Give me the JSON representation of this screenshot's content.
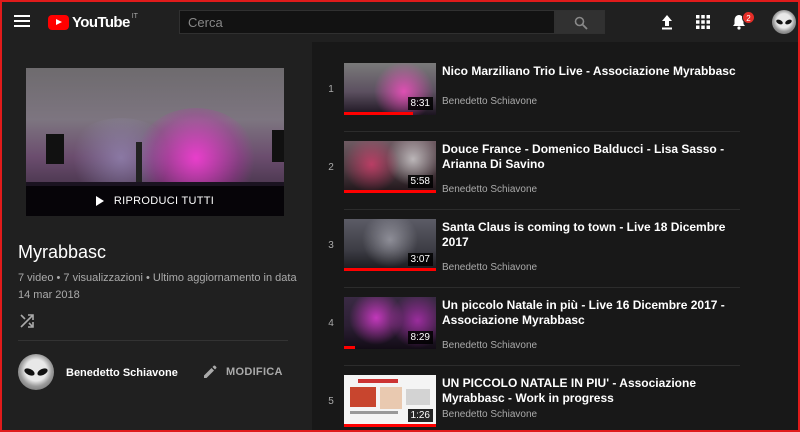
{
  "header": {
    "logo_text": "YouTube",
    "country_code": "IT",
    "search_placeholder": "Cerca",
    "notification_count": "2"
  },
  "playlist": {
    "play_all_label": "RIPRODUCI TUTTI",
    "title": "Myrabbasc",
    "meta": "7 video • 7 visualizzazioni • Ultimo aggiornamento in data 14 mar 2018",
    "owner": "Benedetto Schiavone",
    "edit_label": "MODIFICA"
  },
  "videos": [
    {
      "index": "1",
      "title": "Nico Marziliano Trio Live - Associazione Myrabbasc",
      "channel": "Benedetto Schiavone",
      "duration": "8:31",
      "progress": 0.75
    },
    {
      "index": "2",
      "title": "Douce France - Domenico Balducci - Lisa Sasso - Arianna Di Savino",
      "channel": "Benedetto Schiavone",
      "duration": "5:58",
      "progress": 1.0
    },
    {
      "index": "3",
      "title": "Santa Claus is coming to town - Live 18 Dicembre 2017",
      "channel": "Benedetto Schiavone",
      "duration": "3:07",
      "progress": 1.0
    },
    {
      "index": "4",
      "title": "Un piccolo Natale in più - Live 16 Dicembre 2017 - Associazione Myrabbasc",
      "channel": "Benedetto Schiavone",
      "duration": "8:29",
      "progress": 0.12
    },
    {
      "index": "5",
      "title": "UN PICCOLO NATALE IN PIU' - Associazione Myrabbasc - Work in progress",
      "channel": "Benedetto Schiavone",
      "duration": "1:26",
      "progress": 1.0
    }
  ],
  "colors": {
    "brand_red": "#ff0000",
    "accent_red": "#e01b1b",
    "bg_header": "#202020",
    "bg_list": "#181818"
  }
}
